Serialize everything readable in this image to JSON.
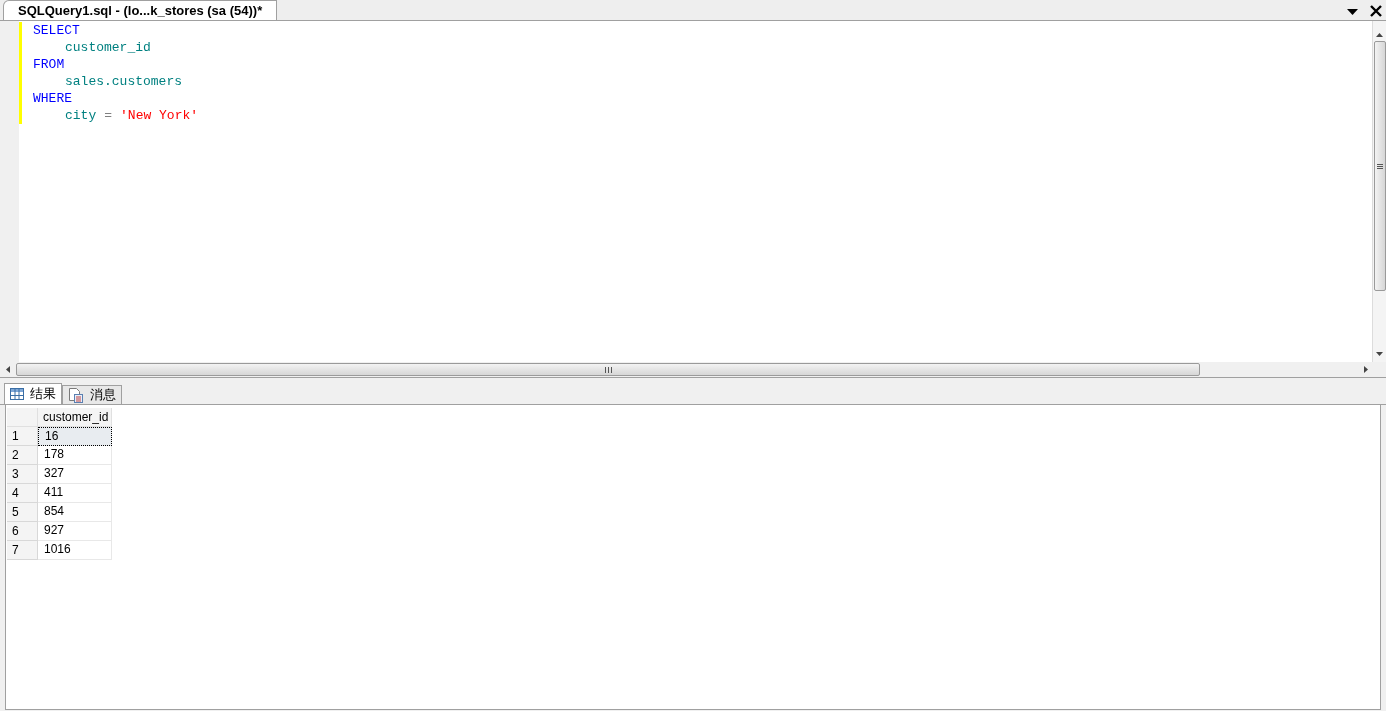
{
  "document_tab": {
    "title": "SQLQuery1.sql - (lo...k_stores (sa (54))*",
    "selected": true
  },
  "editor": {
    "lines": [
      {
        "indented": false,
        "tokens": [
          {
            "text": "SELECT",
            "kind": "keyword"
          }
        ]
      },
      {
        "indented": true,
        "tokens": [
          {
            "text": "customer_id",
            "kind": "identifier"
          }
        ]
      },
      {
        "indented": false,
        "tokens": [
          {
            "text": "FROM",
            "kind": "keyword"
          }
        ]
      },
      {
        "indented": true,
        "tokens": [
          {
            "text": "sales.customers",
            "kind": "identifier"
          }
        ]
      },
      {
        "indented": false,
        "tokens": [
          {
            "text": "WHERE",
            "kind": "keyword"
          }
        ]
      },
      {
        "indented": true,
        "tokens": [
          {
            "text": "city",
            "kind": "identifier"
          },
          {
            "text": "=",
            "kind": "operator"
          },
          {
            "text": "'New York'",
            "kind": "string"
          }
        ]
      }
    ]
  },
  "result_tabs": [
    {
      "label": "结果",
      "kind": "grid",
      "selected": true
    },
    {
      "label": "消息",
      "kind": "messages",
      "selected": false
    }
  ],
  "grid": {
    "columns": [
      "customer_id"
    ],
    "rows": [
      {
        "number": "1",
        "cells": [
          "16"
        ],
        "selected": true
      },
      {
        "number": "2",
        "cells": [
          "178"
        ],
        "selected": false
      },
      {
        "number": "3",
        "cells": [
          "327"
        ],
        "selected": false
      },
      {
        "number": "4",
        "cells": [
          "411"
        ],
        "selected": false
      },
      {
        "number": "5",
        "cells": [
          "854"
        ],
        "selected": false
      },
      {
        "number": "6",
        "cells": [
          "927"
        ],
        "selected": false
      },
      {
        "number": "7",
        "cells": [
          "1016"
        ],
        "selected": false
      }
    ]
  }
}
